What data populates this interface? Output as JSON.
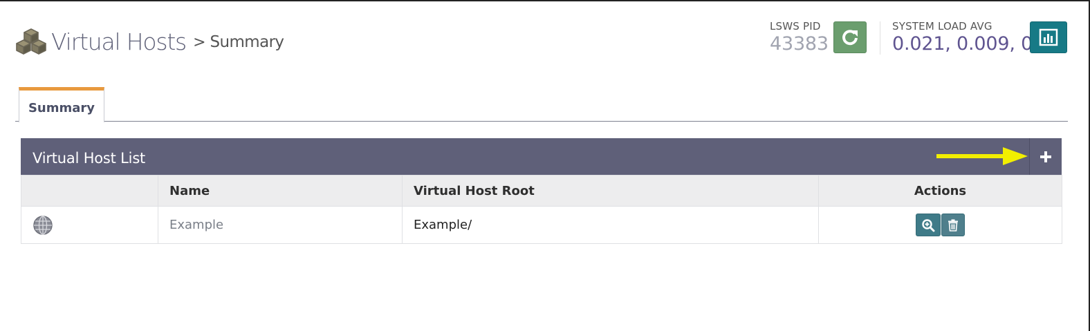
{
  "header": {
    "title": "Virtual Hosts",
    "separator": ">",
    "subtitle": "Summary"
  },
  "stats": {
    "pid_label": "LSWS PID",
    "pid_value": "43383",
    "load_label": "SYSTEM LOAD AVG",
    "load_value": "0.021, 0.009, 0"
  },
  "tabs": [
    {
      "label": "Summary",
      "active": true
    }
  ],
  "panel": {
    "title": "Virtual Host List",
    "columns": [
      "",
      "Name",
      "Virtual Host Root",
      "Actions"
    ],
    "rows": [
      {
        "icon": "globe-icon",
        "name": "Example",
        "root": "Example/"
      }
    ]
  },
  "colors": {
    "panel_header": "#5f6079",
    "tab_accent": "#e8993e",
    "refresh_button": "#6b9e6e",
    "chart_button": "#177a86",
    "action_button": "#3f7b88",
    "annotation_arrow": "#f2ef00"
  },
  "icons": {
    "logo": "cubes-icon",
    "refresh": "refresh-icon",
    "chart": "bar-chart-icon",
    "add": "plus-icon",
    "view": "zoom-in-icon",
    "delete": "trash-icon",
    "annotation": "arrow-right-icon"
  }
}
